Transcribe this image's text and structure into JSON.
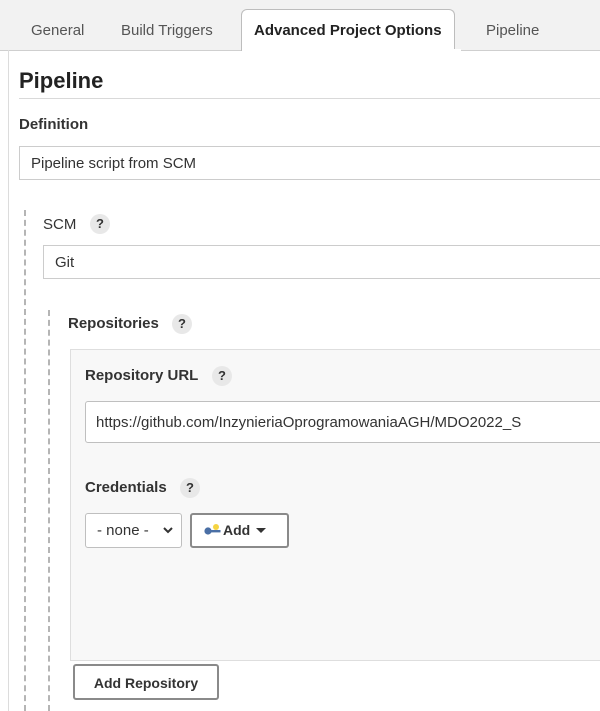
{
  "tabs": [
    {
      "label": "General"
    },
    {
      "label": "Build Triggers"
    },
    {
      "label": "Advanced Project Options",
      "active": true
    },
    {
      "label": "Pipeline"
    }
  ],
  "section": {
    "title": "Pipeline"
  },
  "definition": {
    "label": "Definition",
    "value": "Pipeline script from SCM"
  },
  "scm": {
    "label": "SCM",
    "help": "?",
    "value": "Git"
  },
  "repositories": {
    "label": "Repositories",
    "help": "?",
    "url_label": "Repository URL",
    "url_help": "?",
    "url_value": "https://github.com/InzynieriaOprogramowaniaAGH/MDO2022_S",
    "credentials_label": "Credentials",
    "credentials_help": "?",
    "credentials_value": "- none -",
    "add_button_label": "Add",
    "add_repository_label": "Add Repository"
  },
  "icons": {
    "key": "key-icon",
    "chevron": "chevron-down-icon",
    "caret": "caret-down-icon",
    "help": "help-icon"
  },
  "colors": {
    "tabbar_bg": "#f2f2f2",
    "panel_bg": "#f8f8f8",
    "key_yellow": "#f5d442",
    "key_blue": "#4a6fa5"
  }
}
